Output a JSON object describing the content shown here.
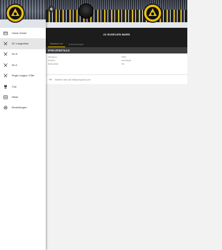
{
  "sidebar": {
    "items": [
      {
        "label": "Game Center",
        "icon": "game-center-icon",
        "active": false
      },
      {
        "label": "SC Langenthal",
        "icon": "team-icon",
        "active": true
      },
      {
        "label": "NL B",
        "icon": "league-icon",
        "active": false
      },
      {
        "label": "NL A",
        "icon": "league-icon",
        "active": false
      },
      {
        "label": "Regio League / Elite",
        "icon": "league-icon",
        "active": false
      },
      {
        "label": "Cup",
        "icon": "trophy-icon",
        "active": false
      },
      {
        "label": "News",
        "icon": "news-icon",
        "active": false
      },
      {
        "label": "Einstellungen",
        "icon": "gear-icon",
        "active": false
      }
    ]
  },
  "player": {
    "title": "#3 GUGELIEN MARS"
  },
  "tabs": [
    {
      "label": "ÜBERSICHT",
      "active": true
    },
    {
      "label": "STATISTIKEN",
      "active": false
    }
  ],
  "details": {
    "header": "SPIELERDETAILS",
    "rows": [
      {
        "label": "Jahrgang",
        "value": "1994"
      },
      {
        "label": "Position",
        "value": "Verteidiger"
      },
      {
        "label": "Nationalität",
        "value": "CH"
      }
    ],
    "link": "Weitere Infos auf eliteprospects.com"
  },
  "colors": {
    "accent": "#d9b100",
    "dark_bar": "#1c1c1c",
    "section_bar": "#3c3c3c"
  }
}
